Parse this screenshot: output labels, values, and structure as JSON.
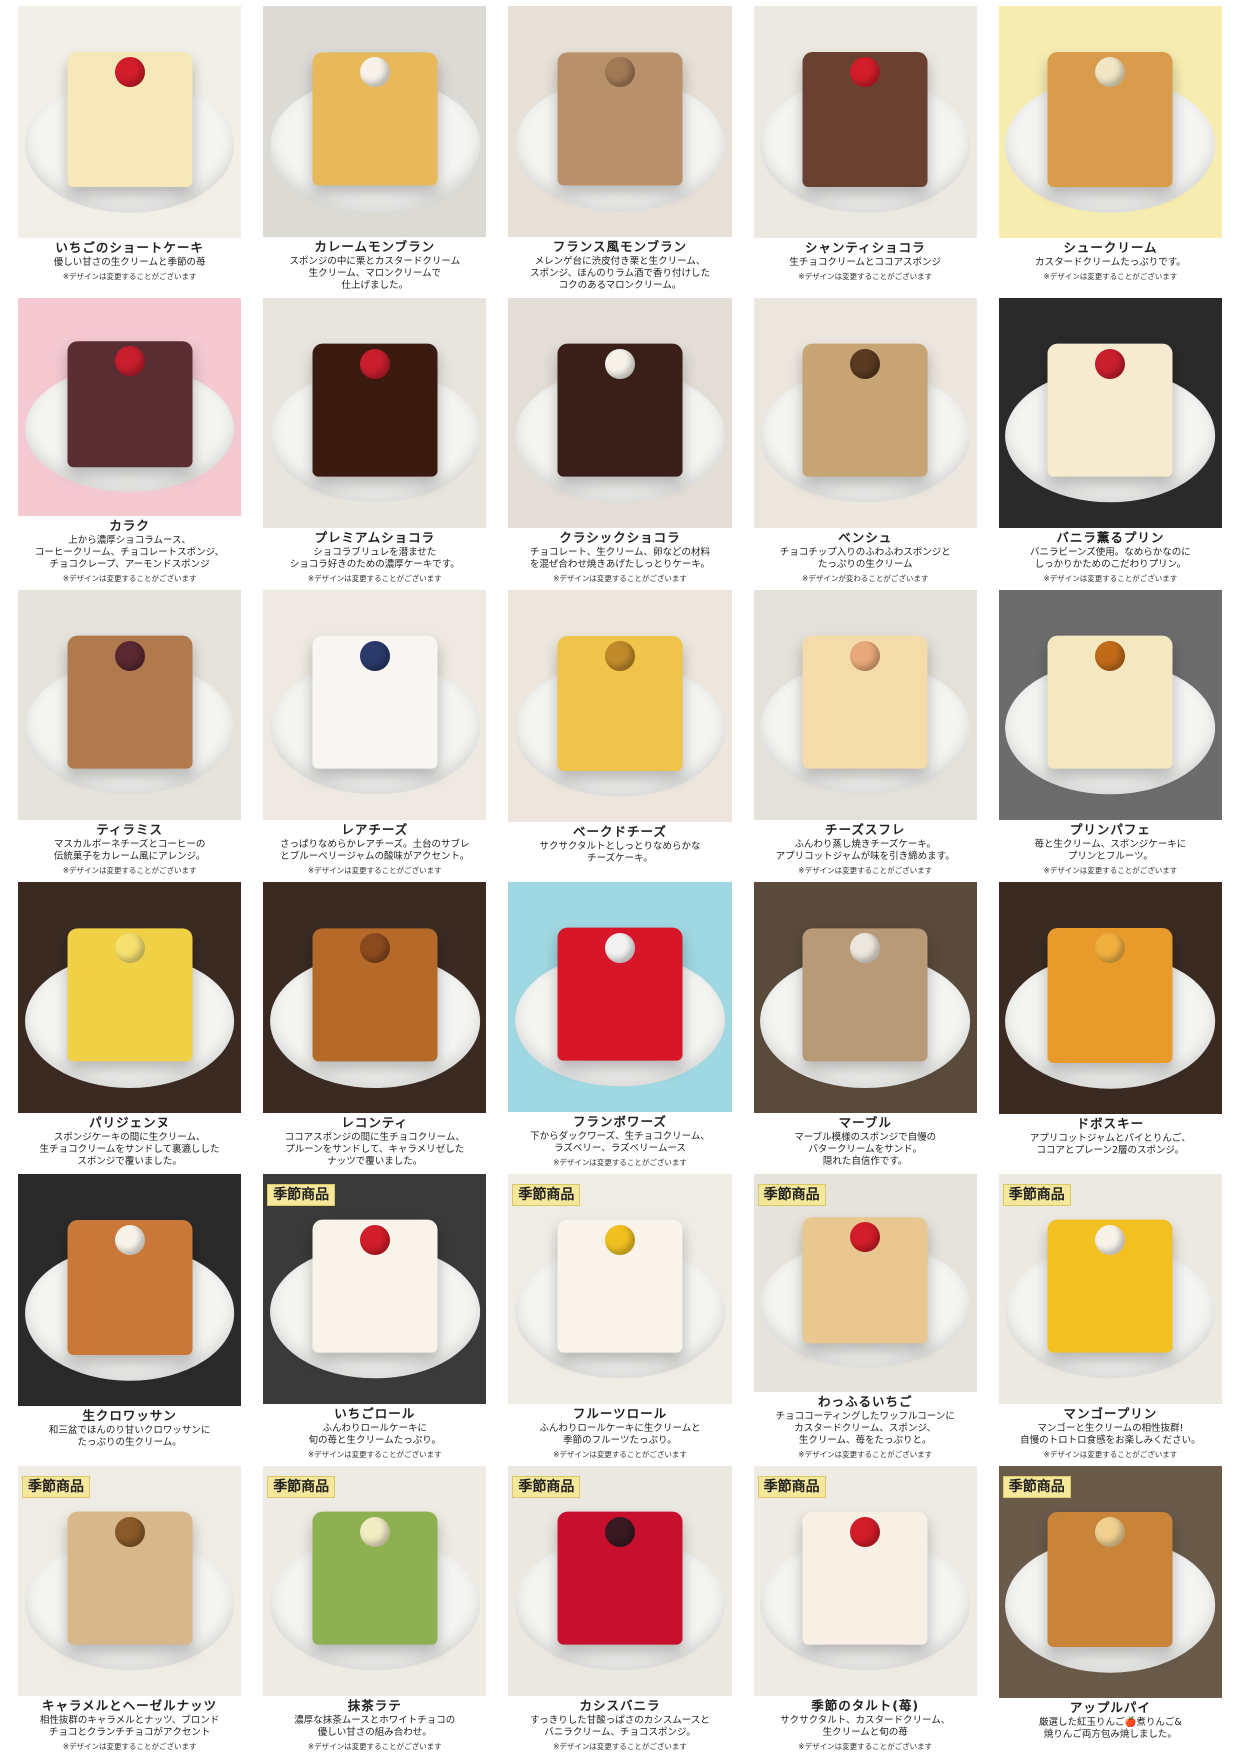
{
  "items": [
    {
      "name": "いちごのショートケーキ",
      "desc": "優しい甘さの生クリームと季節の苺",
      "note": "※デザインは変更することがございます",
      "seasonal": "",
      "bg": "#f2efe8",
      "cake": "#f6e8b8",
      "top": "#d21d2a"
    },
    {
      "name": "カレームモンブラン",
      "desc": "スポンジの中に栗とカスタードクリーム\n生クリーム、マロンクリームで\n仕上げました。",
      "note": "",
      "seasonal": "",
      "bg": "#dcdad4",
      "cake": "#e8b95a",
      "top": "#f7f3ea"
    },
    {
      "name": "フランス風モンブラン",
      "desc": "メレンゲ台に渋皮付き栗と生クリーム、\nスポンジ、ほんのりラム酒で香り付けした\nコクのあるマロンクリーム。",
      "note": "",
      "seasonal": "",
      "bg": "#e6e0d6",
      "cake": "#b8906a",
      "top": "#a07a55"
    },
    {
      "name": "シャンティショコラ",
      "desc": "生チョコクリームとココアスポンジ",
      "note": "※デザインは変更することがございます",
      "seasonal": "",
      "bg": "#ece8e2",
      "cake": "#6a4030",
      "top": "#d21d2a"
    },
    {
      "name": "シュークリーム",
      "desc": "カスタードクリームたっぷりです。",
      "note": "※デザインは変更することがございます",
      "seasonal": "",
      "bg": "#f7ecb0",
      "cake": "#d89c4c",
      "top": "#f2e6c4"
    },
    {
      "name": "カラク",
      "desc": "上から濃厚ショコラムース、\nコーヒークリーム、チョコレートスポンジ、\nチョコクレープ、アーモンドスポンジ",
      "note": "※デザインは変更することがございます",
      "seasonal": "",
      "bg": "#f4c9d2",
      "cake": "#5a2d32",
      "top": "#c81e2e"
    },
    {
      "name": "プレミアムショコラ",
      "desc": "ショコラブリュレを潜ませた\nショコラ好きのための濃厚ケーキです。",
      "note": "※デザインは変更することがございます",
      "seasonal": "",
      "bg": "#e8e4de",
      "cake": "#3b1a10",
      "top": "#c81e2e"
    },
    {
      "name": "クラシックショコラ",
      "desc": "チョコレート、生クリーム、卵などの材料\nを混ぜ合わせ焼きあげたしっとりケーキ。",
      "note": "※デザインは変更することがございます",
      "seasonal": "",
      "bg": "#e2ddd6",
      "cake": "#3a1f18",
      "top": "#f7f3ea"
    },
    {
      "name": "ベンシュ",
      "desc": "チョコチップ入りのふわふわスポンジと\nたっぷりの生クリーム",
      "note": "※デザインが変わることがございます",
      "seasonal": "",
      "bg": "#ebe6de",
      "cake": "#c7a474",
      "top": "#5a3a22"
    },
    {
      "name": "バニラ薫るプリン",
      "desc": "バニラビーンズ使用。なめらかなのに\nしっかりかためのこだわりプリン。",
      "note": "※デザインは変更することがございます",
      "seasonal": "",
      "bg": "#2a2a2a",
      "cake": "#f6ead0",
      "top": "#c81e2e"
    },
    {
      "name": "ティラミス",
      "desc": "マスカルポーネチーズとコーヒーの\n伝統菓子をカレーム風にアレンジ。",
      "note": "※デザインは変更することがございます",
      "seasonal": "",
      "bg": "#e6e2dc",
      "cake": "#b07a4e",
      "top": "#5a2830"
    },
    {
      "name": "レアチーズ",
      "desc": "さっぱりなめらかレアチーズ。土台のサブレ\nとブルーベリージャムの酸味がアクセント。",
      "note": "※デザインは変更することがございます",
      "seasonal": "",
      "bg": "#eee9e2",
      "cake": "#f8f6f2",
      "top": "#2b3a6a"
    },
    {
      "name": "ベークドチーズ",
      "desc": "サクサクタルトとしっとりなめらかな\nチーズケーキ。",
      "note": "",
      "seasonal": "",
      "bg": "#ece6dc",
      "cake": "#f0c34a",
      "top": "#c08a2a"
    },
    {
      "name": "チーズスフレ",
      "desc": "ふんわり蒸し焼きチーズケーキ。\nアプリコットジャムが味を引き締めます。",
      "note": "※デザインは変更することがございます",
      "seasonal": "",
      "bg": "#e4e0da",
      "cake": "#f3dcaa",
      "top": "#e8a87a"
    },
    {
      "name": "プリンパフェ",
      "desc": "苺と生クリーム、スポンジケーキに\nプリンとフルーツ。",
      "note": "※デザインは変更することがございます",
      "seasonal": "",
      "bg": "#6c6c6c",
      "cake": "#f5e8c0",
      "top": "#c06a1a"
    },
    {
      "name": "パリジェンヌ",
      "desc": "スポンジケーキの間に生クリーム、\n生チョコクリームをサンドして裏漉しした\nスポンジで覆いました。",
      "note": "",
      "seasonal": "",
      "bg": "#3a2a22",
      "cake": "#f0d045",
      "top": "#f5e070"
    },
    {
      "name": "レコンティ",
      "desc": "ココアスポンジの間に生チョコクリーム、\nプルーンをサンドして、キャラメリゼした\nナッツで覆いました。",
      "note": "",
      "seasonal": "",
      "bg": "#3a2a22",
      "cake": "#b56a2a",
      "top": "#8a4a1e"
    },
    {
      "name": "フランボワーズ",
      "desc": "下からダックワーズ、生チョコクリーム、\nラズベリー、ラズベリームース",
      "note": "※デザインは変更することがございます",
      "seasonal": "",
      "bg": "#9fd7e2",
      "cake": "#d8162a",
      "top": "#f2f2f2"
    },
    {
      "name": "マーブル",
      "desc": "マーブル模様のスポンジで自慢の\nバタークリームをサンド。\n隠れた自信作です。",
      "note": "",
      "seasonal": "",
      "bg": "#5a4a3c",
      "cake": "#b89a78",
      "top": "#ece6dc"
    },
    {
      "name": "ドボスキー",
      "desc": "アプリコットジャムとパイとりんご、\nココアとプレーン2層のスポンジ。",
      "note": "",
      "seasonal": "",
      "bg": "#3a2a22",
      "cake": "#e89a2a",
      "top": "#f0b040"
    },
    {
      "name": "生クロワッサン",
      "desc": "和三盆でほんのり甘いクロワッサンに\nたっぷりの生クリーム。",
      "note": "",
      "seasonal": "",
      "bg": "#2a2a2a",
      "cake": "#c9783a",
      "top": "#f7f3ea"
    },
    {
      "name": "いちごロール",
      "desc": "ふんわりロールケーキに\n旬の苺と生クリームたっぷり。",
      "note": "※デザインは変更することがございます",
      "seasonal": "季節商品",
      "bg": "#3a3a3a",
      "cake": "#f8f4ea",
      "top": "#d21d2a"
    },
    {
      "name": "フルーツロール",
      "desc": "ふんわりロールケーキに生クリームと\n季節のフルーツたっぷり。",
      "note": "※デザインは変更することがございます",
      "seasonal": "季節商品",
      "bg": "#efece6",
      "cake": "#f8f4ea",
      "top": "#f0c020"
    },
    {
      "name": "わっふるいちご",
      "desc": "チョココーティングしたワッフルコーンに\nカスタードクリーム、スポンジ、\n生クリーム、苺をたっぷりと。",
      "note": "※デザインは変更することがございます",
      "seasonal": "季節商品",
      "bg": "#e6e2dc",
      "cake": "#e8c890",
      "top": "#d21d2a"
    },
    {
      "name": "マンゴープリン",
      "desc": "マンゴーと生クリームの相性抜群!\n自慢のトロトロ食感をお楽しみください。",
      "note": "※デザインは変更することがございます",
      "seasonal": "季節商品",
      "bg": "#ece8e2",
      "cake": "#f2c020",
      "top": "#f7f3ea"
    },
    {
      "name": "キャラメルとヘーゼルナッツ",
      "desc": "相性抜群のキャラメルとナッツ、ブロンド\nチョコとクランチチョコがアクセント",
      "note": "※デザインは変更することがございます",
      "seasonal": "季節商品",
      "bg": "#efebe5",
      "cake": "#d8b88a",
      "top": "#8a5a2a"
    },
    {
      "name": "抹茶ラテ",
      "desc": "濃厚な抹茶ムースとホワイトチョコの\n優しい甘さの組み合わせ。",
      "note": "※デザインは変更することがございます",
      "seasonal": "季節商品",
      "bg": "#eeeae4",
      "cake": "#8db050",
      "top": "#f2ecc4"
    },
    {
      "name": "カシスバニラ",
      "desc": "すっきりした甘酸っぱさのカシスムースと\nバニラクリーム、チョコスポンジ。",
      "note": "※デザインは変更することがございます",
      "seasonal": "季節商品",
      "bg": "#ebe7e1",
      "cake": "#c8102e",
      "top": "#3a1a22"
    },
    {
      "name": "季節のタルト(苺)",
      "desc": "サクサクタルト、カスタードクリーム、\n生クリームと旬の苺",
      "note": "※デザインは変更することがございます",
      "seasonal": "季節商品",
      "bg": "#eeeae4",
      "cake": "#f8f0e4",
      "top": "#d21d2a"
    },
    {
      "name": "アップルパイ",
      "desc": "厳選した紅玉りんご🍎煮りんご&\n焼りんご両方包み焼しました。",
      "note": "",
      "seasonal": "季節商品",
      "bg": "#6a5a4a",
      "cake": "#c9843a",
      "top": "#f0d090"
    }
  ]
}
